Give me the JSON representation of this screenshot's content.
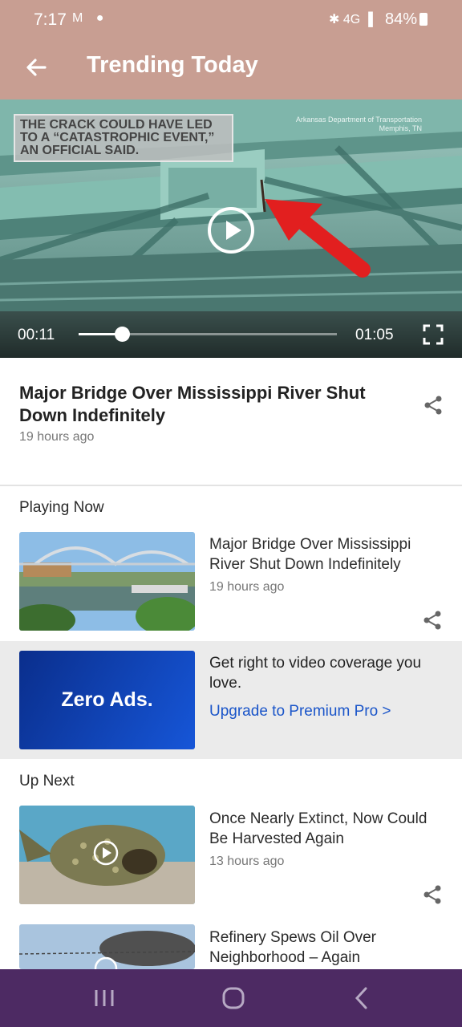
{
  "status_bar": {
    "time": "7:17",
    "left_icons": "M ●",
    "right_icons": "✱ 4G ▐",
    "battery": "84%"
  },
  "header": {
    "title": "Trending Today",
    "back_icon": "arrow-left-icon"
  },
  "video": {
    "caption": "THE CRACK COULD HAVE LED TO A “CATASTROPHIC EVENT,” AN OFFICIAL SAID.",
    "credit_line1": "Arkansas Department of Transportation",
    "credit_line2": "Memphis, TN",
    "current_time": "00:11",
    "duration": "01:05",
    "progress_fraction": 0.17,
    "play_icon": "play-icon",
    "fullscreen_icon": "fullscreen-icon"
  },
  "article": {
    "title": "Major Bridge Over Mississippi River Shut Down Indefinitely",
    "time": "19 hours ago",
    "share_icon": "share-icon"
  },
  "playing_now": {
    "heading": "Playing Now",
    "item": {
      "title": "Major Bridge Over Mississippi River Shut Down Indefinitely",
      "time": "19 hours ago"
    }
  },
  "promo": {
    "card_text": "Zero Ads.",
    "text": "Get right to video coverage you love.",
    "link": "Upgrade to Premium Pro >"
  },
  "up_next": {
    "heading": "Up Next",
    "items": [
      {
        "title": "Once Nearly Extinct, Now Could Be Harvested Again",
        "time": "13 hours ago"
      },
      {
        "title": "Refinery Spews Oil Over Neighborhood – Again",
        "time": ""
      }
    ]
  },
  "nav_bar": {
    "recents_icon": "recent-apps-icon",
    "home_icon": "home-icon",
    "back_icon": "back-icon"
  },
  "colors": {
    "header_bg": "#c89e92",
    "nav_bg": "#4d2a63",
    "link": "#1a55c9",
    "promo_blue": "#1656d8"
  }
}
